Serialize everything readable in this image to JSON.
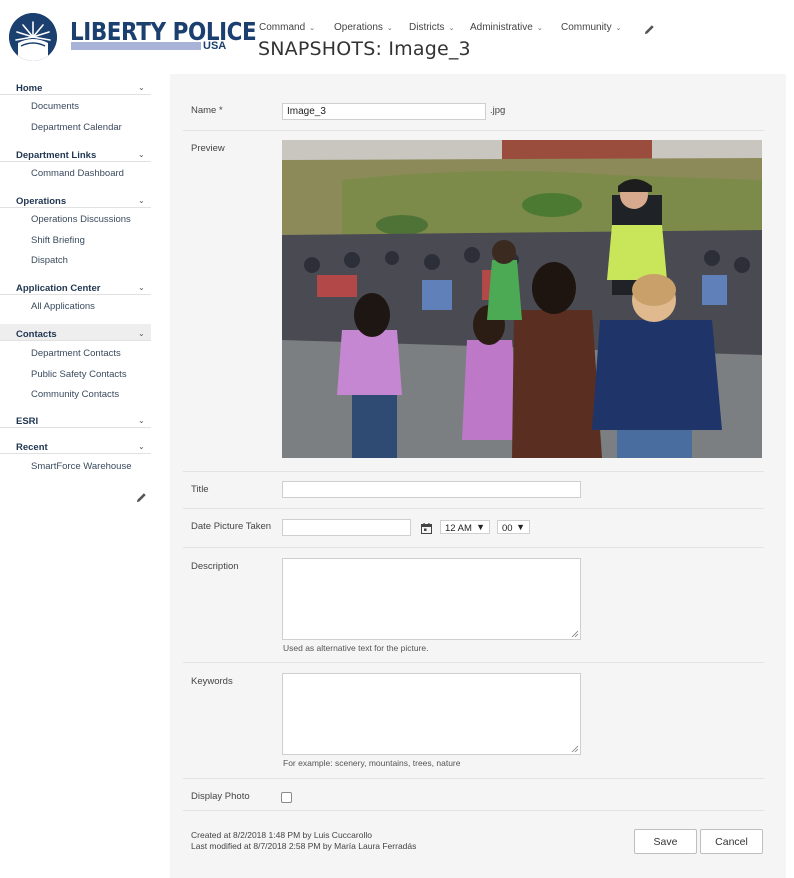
{
  "brand": {
    "name": "LIBERTY POLICE",
    "suffix": "USA"
  },
  "topnav": [
    {
      "label": "Command"
    },
    {
      "label": "Operations"
    },
    {
      "label": "Districts"
    },
    {
      "label": "Administrative"
    },
    {
      "label": "Community"
    }
  ],
  "page_title": "SNAPSHOTS: Image_3",
  "leftnav": {
    "sections": [
      {
        "label": "Home",
        "items": [
          "Documents",
          "Department Calendar"
        ]
      },
      {
        "label": "Department Links",
        "items": [
          "Command Dashboard"
        ]
      },
      {
        "label": "Operations",
        "items": [
          "Operations Discussions",
          "Shift Briefing",
          "Dispatch"
        ]
      },
      {
        "label": "Application Center",
        "items": [
          "All Applications"
        ]
      },
      {
        "label": "Contacts",
        "items": [
          "Department Contacts",
          "Public Safety Contacts",
          "Community Contacts"
        ]
      },
      {
        "label": "ESRI",
        "items": []
      },
      {
        "label": "Recent",
        "items": [
          "SmartForce Warehouse"
        ]
      }
    ],
    "active_section": "Contacts"
  },
  "form": {
    "name_label": "Name *",
    "name_value": "Image_3",
    "name_ext": ".jpg",
    "preview_label": "Preview",
    "title_label": "Title",
    "title_value": "",
    "date_label": "Date Picture Taken",
    "date_value": "",
    "hour_value": "12 AM",
    "minute_value": "00",
    "description_label": "Description",
    "description_value": "",
    "description_hint": "Used as alternative text for the picture.",
    "keywords_label": "Keywords",
    "keywords_value": "",
    "keywords_hint": "For example: scenery, mountains, trees, nature",
    "display_photo_label": "Display Photo",
    "display_photo_checked": false
  },
  "footer": {
    "created": "Created at 8/2/2018 1:48 PM  by Luis Cuccarollo",
    "modified": "Last modified at 8/7/2018 2:58 PM  by María Laura Ferradás",
    "save_label": "Save",
    "cancel_label": "Cancel"
  },
  "colors": {
    "brand_navy": "#1b3f6e",
    "brand_bar": "#a9b3d8",
    "panel_bg": "#f5f5f5",
    "active_nav_bg": "#eeeeee"
  }
}
